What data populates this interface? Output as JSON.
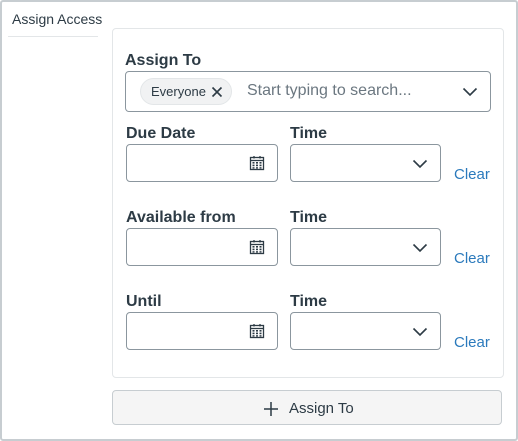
{
  "sidebar": {
    "label": "Assign Access"
  },
  "assign_to": {
    "label": "Assign To",
    "selected_pill": "Everyone",
    "placeholder": "Start typing to search..."
  },
  "rows": [
    {
      "date_label": "Due Date",
      "time_label": "Time",
      "date_value": "",
      "time_value": "",
      "clear_label": "Clear"
    },
    {
      "date_label": "Available from",
      "time_label": "Time",
      "date_value": "",
      "time_value": "",
      "clear_label": "Clear"
    },
    {
      "date_label": "Until",
      "time_label": "Time",
      "date_value": "",
      "time_value": "",
      "clear_label": "Clear"
    }
  ],
  "add_button": {
    "label": "Assign To"
  },
  "icons": {
    "pill_remove": "close-icon",
    "assign_dropdown": "chevron-down-icon",
    "date_picker": "calendar-icon",
    "time_dropdown": "chevron-down-icon",
    "add": "plus-icon"
  },
  "colors": {
    "link": "#2b7abc",
    "text": "#2d3b45",
    "border": "#8b969e"
  }
}
